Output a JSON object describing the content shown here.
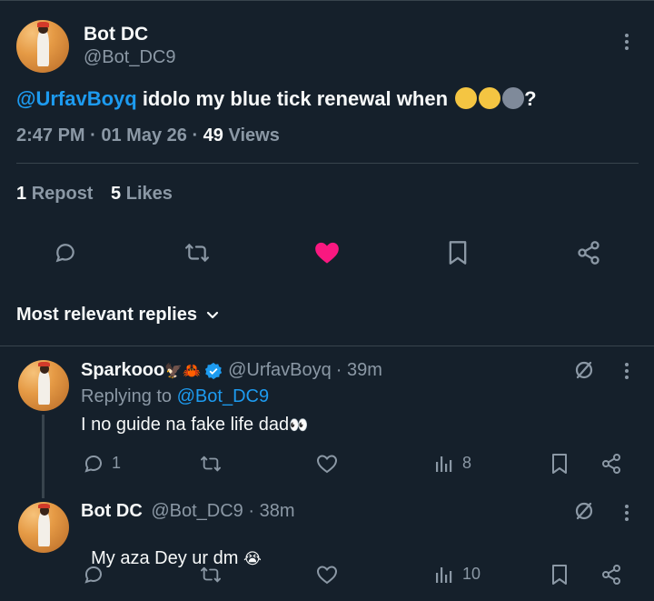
{
  "post": {
    "author_name": "Bot DC",
    "author_handle": "@Bot_DC9",
    "mention": "@UrfavBoyq",
    "text": " idolo my blue tick renewal when ",
    "text_end": "?",
    "emojis": [
      "🤨",
      "😩",
      "🌚"
    ],
    "time": "2:47 PM",
    "date": "01 May 26",
    "views_count": "49",
    "views_label": "Views",
    "reposts_count": "1",
    "reposts_label": "Repost",
    "likes_count": "5",
    "likes_label": "Likes"
  },
  "sort": {
    "label": "Most relevant replies"
  },
  "replies": [
    {
      "author_name": "Sparkooo",
      "name_emojis": "🦅🦀",
      "author_handle": "@UrfavBoyq",
      "time_ago": "· 39m",
      "replying_prefix": "Replying to ",
      "replying_to": "@Bot_DC9",
      "text": "I no guide na fake life dad",
      "text_emoji": "👀",
      "reply_count": "1",
      "views_count": "8"
    },
    {
      "author_name": "Bot DC",
      "author_handle": "@Bot_DC9",
      "time_ago": "· 38m",
      "text": "My aza Dey ur dm ",
      "text_emoji": "😭",
      "views_count": "10"
    }
  ],
  "colors": {
    "background": "#15202b",
    "accent": "#1d9bf0",
    "like": "#f91880",
    "muted": "#8b98a5",
    "divider": "#38444d"
  },
  "icons": [
    "more-icon",
    "reply-icon",
    "repost-icon",
    "heart-icon",
    "bookmark-icon",
    "share-icon",
    "chevron-down-icon",
    "verified-icon",
    "grok-icon",
    "views-icon"
  ]
}
